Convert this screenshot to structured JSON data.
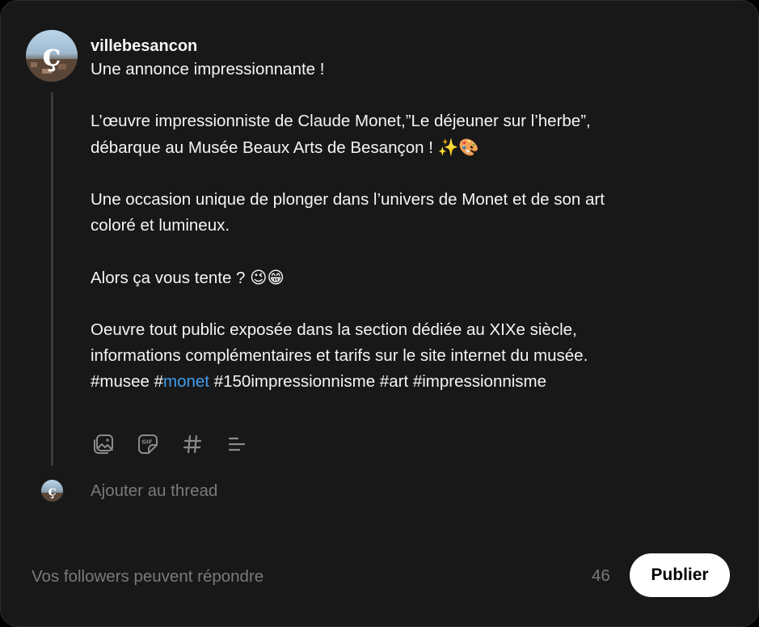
{
  "post": {
    "username": "villebesancon",
    "lines": [
      "Une annonce impressionnante !",
      "",
      "L’œuvre impressionniste de Claude Monet,”Le déjeuner sur l’herbe”,",
      "débarque au Musée Beaux Arts de Besançon ! ",
      "",
      "Une occasion unique de plonger dans l’univers de Monet et de son art",
      "coloré et lumineux.",
      "",
      "Alors ça vous tente ? ",
      "",
      "Oeuvre tout public exposée dans la section dédiée au XIXe siècle,",
      "informations complémentaires et tarifs sur le site internet du musée."
    ],
    "emoji_line4": "✨🎨",
    "emoji_line9": "😉😁",
    "hashtags": {
      "before": "#musee #",
      "link": "monet",
      "after": " #150impressionnisme #art #impressionnisme"
    }
  },
  "toolbar": {
    "icons": [
      "media-icon",
      "gif-icon",
      "hashtag-icon",
      "list-icon"
    ]
  },
  "thread": {
    "placeholder": "Ajouter au thread"
  },
  "footer": {
    "reply_setting": "Vos followers peuvent répondre",
    "char_count": "46",
    "publish_label": "Publier"
  },
  "colors": {
    "background": "#181818",
    "link": "#3f9ded",
    "muted": "#7a7a7a",
    "button": "#ffffff"
  }
}
